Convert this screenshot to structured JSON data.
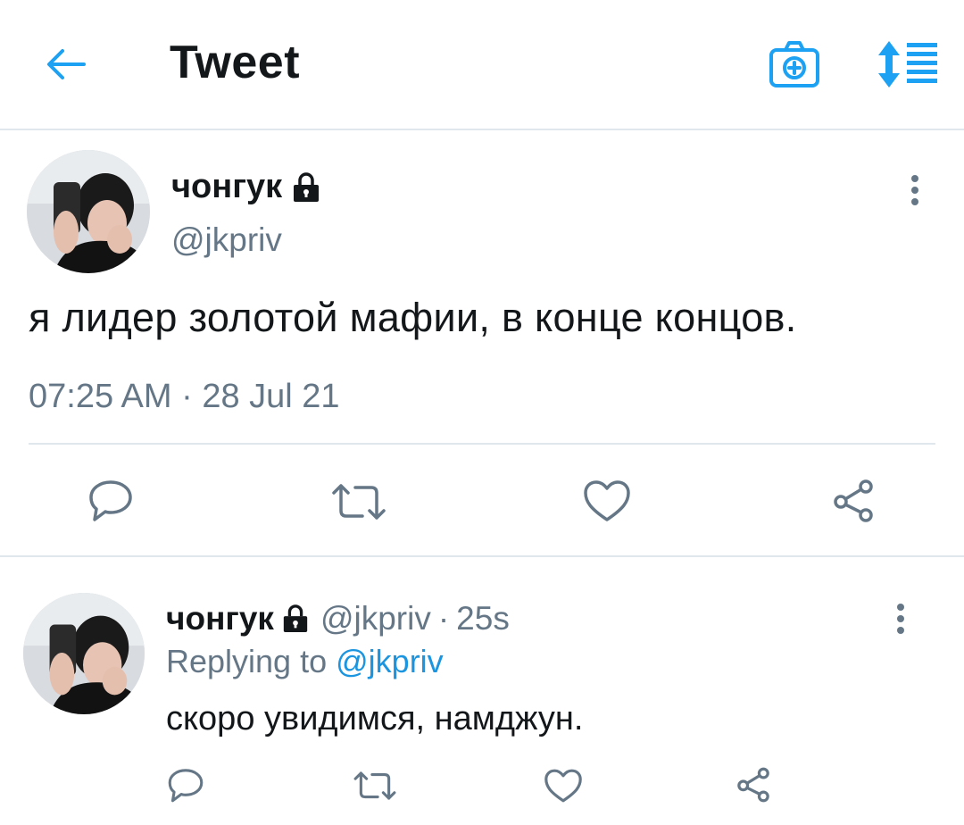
{
  "header": {
    "title": "Tweet",
    "back_icon": "arrow-left-icon",
    "camera_icon": "camera-plus-icon",
    "sort_icon": "sort-list-icon",
    "accent": "#1da1f2"
  },
  "main_tweet": {
    "author_name": "чонгук",
    "handle": "@jkpriv",
    "locked_icon": "lock-icon",
    "text": "я лидер золотой мафии, в конце концов.",
    "timestamp": "07:25 AM · 28 Jul 21",
    "actions": [
      "reply-icon",
      "retweet-icon",
      "like-icon",
      "share-icon"
    ]
  },
  "reply_tweet": {
    "author_name": "чонгук",
    "handle": "@jkpriv",
    "separator": "·",
    "time_ago": "25s",
    "replying_to_label": "Replying to",
    "replying_to_handle": "@jkpriv",
    "text": "скоро увидимся, намджун.",
    "actions": [
      "reply-icon",
      "retweet-icon",
      "like-icon",
      "share-icon"
    ]
  },
  "colors": {
    "text": "#14171a",
    "secondary": "#657786",
    "link": "#1b95e0",
    "border": "#e1e8ed"
  }
}
